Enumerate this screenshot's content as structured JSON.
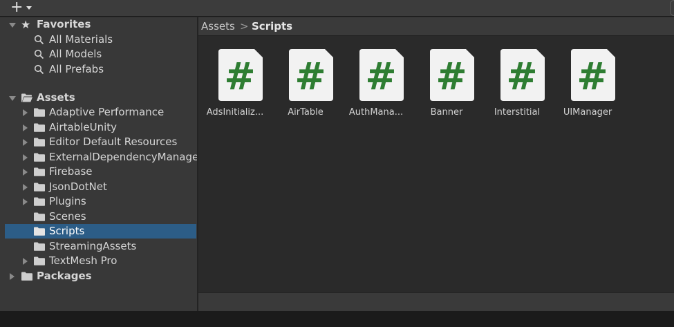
{
  "toolbar": {
    "add_label": "+"
  },
  "tree": {
    "favorites": {
      "label": "Favorites",
      "items": [
        {
          "label": "All Materials"
        },
        {
          "label": "All Models"
        },
        {
          "label": "All Prefabs"
        }
      ]
    },
    "assets": {
      "label": "Assets",
      "items": [
        {
          "label": "Adaptive Performance",
          "has_children": true
        },
        {
          "label": "AirtableUnity",
          "has_children": true
        },
        {
          "label": "Editor Default Resources",
          "has_children": true
        },
        {
          "label": "ExternalDependencyManager",
          "has_children": true
        },
        {
          "label": "Firebase",
          "has_children": true
        },
        {
          "label": "JsonDotNet",
          "has_children": true
        },
        {
          "label": "Plugins",
          "has_children": true
        },
        {
          "label": "Scenes",
          "has_children": false
        },
        {
          "label": "Scripts",
          "has_children": false,
          "selected": true
        },
        {
          "label": "StreamingAssets",
          "has_children": false
        },
        {
          "label": "TextMesh Pro",
          "has_children": true
        }
      ]
    },
    "packages": {
      "label": "Packages"
    }
  },
  "breadcrumb": {
    "root": "Assets",
    "separator": ">",
    "current": "Scripts"
  },
  "assets_grid": {
    "items": [
      {
        "label": "AdsInitializ...",
        "glyph": "#"
      },
      {
        "label": "AirTable",
        "glyph": "#"
      },
      {
        "label": "AuthMana...",
        "glyph": "#"
      },
      {
        "label": "Banner",
        "glyph": "#"
      },
      {
        "label": "Interstitial",
        "glyph": "#"
      },
      {
        "label": "UIManager",
        "glyph": "#"
      }
    ]
  },
  "colors": {
    "selection": "#2c5d87",
    "script_hash": "#2e7d32",
    "doc_background": "#f2f2f2"
  }
}
